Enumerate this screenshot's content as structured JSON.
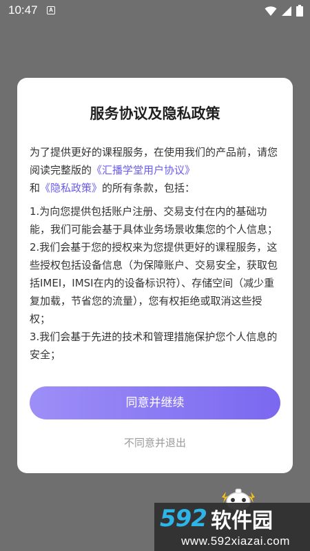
{
  "status_bar": {
    "time": "10:47",
    "notification_icon_letter": "A",
    "icons": [
      "wifi-icon",
      "signal-icon",
      "battery-icon"
    ]
  },
  "dialog": {
    "title": "服务协议及隐私政策",
    "intro": {
      "prefix": "为了提供更好的课程服务，在使用我们的产品前，请您阅读完整版的",
      "link1": "《汇播学堂用户协议》",
      "middle": "和",
      "link2": "《隐私政策》",
      "suffix": "的所有条款，包括："
    },
    "items": [
      "1.为向您提供包括账户注册、交易支付在内的基础功能，我们可能会基于具体业务场景收集您的个人信息；",
      "2.我们会基于您的授权来为您提供更好的课程服务，这些授权包括设备信息（为保障账户、交易安全，获取包括IMEI，IMSI在内的设备标识符）、存储空间（减少重复加载，节省您的流量），您有权拒绝或取消这些授权；",
      "3.我们会基于先进的技术和管理措施保护您个人信息的安全；"
    ],
    "agree_label": "同意并继续",
    "disagree_label": "不同意并退出"
  },
  "watermark": {
    "number": "592",
    "name": "软件园",
    "url": "www.592xiazai.com"
  },
  "colors": {
    "overlay": "#6f6f6f",
    "link": "#6a5cf0",
    "button_start": "#9d8ff7",
    "button_end": "#7a68f0",
    "watermark_number": "#2fb4e8"
  }
}
